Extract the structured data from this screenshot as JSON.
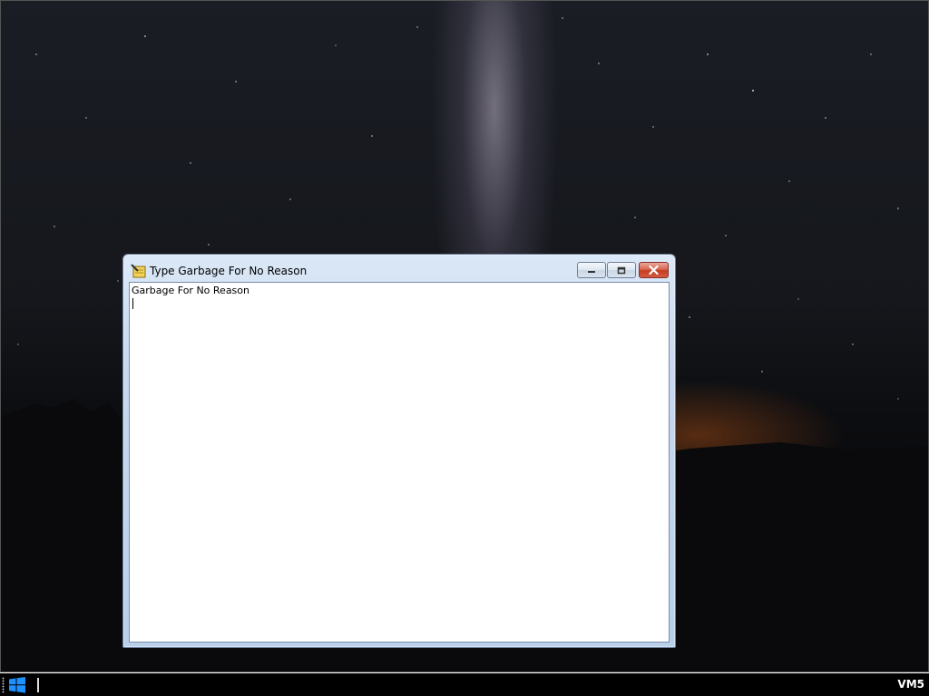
{
  "window": {
    "title": "Type Garbage For No Reason",
    "icon": "notepad-pencil-icon",
    "content_text": "Garbage For No Reason",
    "controls": [
      "minimize-icon",
      "maximize-icon",
      "close-icon"
    ]
  },
  "taskbar": {
    "start_icon": "windows-logo-icon",
    "tray_label": "VM5"
  },
  "colors": {
    "titlebar": "#c6d8ee",
    "close_button": "#c43d22",
    "taskbar": "#000000"
  }
}
